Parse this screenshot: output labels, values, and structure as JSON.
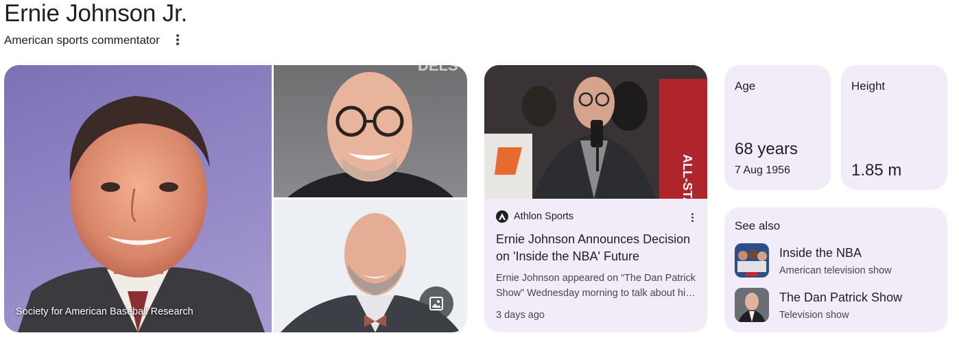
{
  "header": {
    "title": "Ernie Johnson Jr.",
    "subtitle": "American sports commentator"
  },
  "gallery": {
    "main_caption": "Society for American Baseball Research"
  },
  "news": {
    "source": "Athlon Sports",
    "title": "Ernie Johnson Announces Decision on 'Inside the NBA' Future",
    "snippet": "Ernie Johnson appeared on “The Dan Patrick Show” Wednesday morning to talk about his future on Inside the NBA.",
    "time": "3 days ago"
  },
  "facts": {
    "age": {
      "label": "Age",
      "value": "68 years",
      "sub": "7 Aug 1956"
    },
    "height": {
      "label": "Height",
      "value": "1.85 m"
    }
  },
  "see_also": {
    "title": "See also",
    "items": [
      {
        "name": "Inside the NBA",
        "desc": "American television show"
      },
      {
        "name": "The Dan Patrick Show",
        "desc": "Television show"
      }
    ]
  },
  "colors": {
    "card_bg": "#f1ecf7",
    "text": "#1f1f1f",
    "secondary_text": "#474747"
  }
}
